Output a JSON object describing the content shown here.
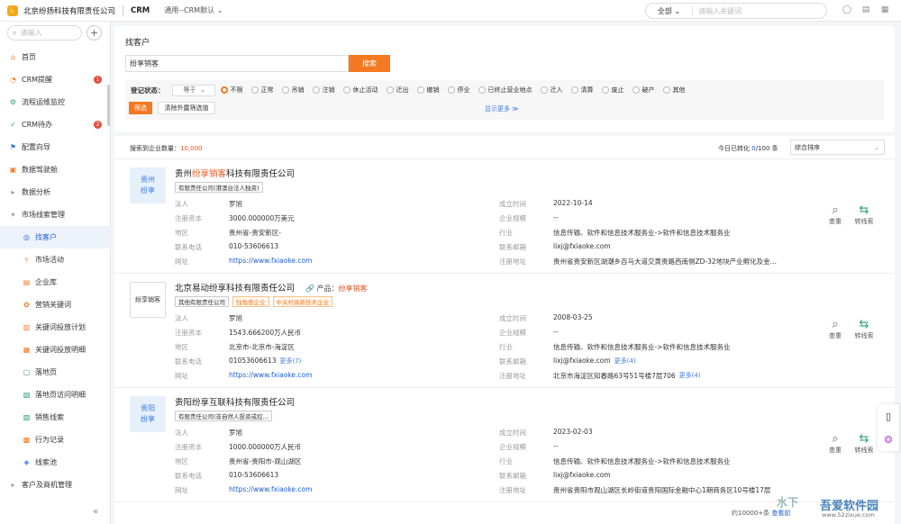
{
  "topbar": {
    "company": "北京纷扬科技有限责任公司",
    "app": "CRM",
    "workspace": "通用--CRM默认",
    "scope": "全部",
    "search_placeholder": "请输入关键词"
  },
  "sidebar": {
    "search_placeholder": "请输入",
    "items": [
      {
        "label": "首页",
        "icon": "home-icon",
        "glyph": "⌂",
        "color": "#f47921"
      },
      {
        "label": "CRM提醒",
        "icon": "bell-icon",
        "glyph": "◔",
        "color": "#f47921",
        "badge": "1"
      },
      {
        "label": "流程运维监控",
        "icon": "flow-icon",
        "glyph": "⚙",
        "color": "#2aa36b"
      },
      {
        "label": "CRM待办",
        "icon": "todo-icon",
        "glyph": "✓",
        "color": "#2aa36b",
        "badge": "2"
      },
      {
        "label": "配置向导",
        "icon": "guide-icon",
        "glyph": "⚑",
        "color": "#3a7be0"
      },
      {
        "label": "数据驾驶舱",
        "icon": "dashboard-icon",
        "glyph": "▣",
        "color": "#f47921"
      },
      {
        "label": "数据分析",
        "icon": "expand-icon",
        "glyph": "▸",
        "color": "#999"
      },
      {
        "label": "市场线索管理",
        "icon": "collapse-icon",
        "glyph": "▾",
        "color": "#999"
      },
      {
        "label": "找客户",
        "icon": "find-customer-icon",
        "glyph": "◎",
        "color": "#1a5ed8",
        "sub": true,
        "active": true
      },
      {
        "label": "市场活动",
        "icon": "activity-icon",
        "glyph": "✧",
        "color": "#f47921",
        "sub": true
      },
      {
        "label": "企业库",
        "icon": "company-icon",
        "glyph": "▤",
        "color": "#f47921",
        "sub": true
      },
      {
        "label": "营销关键词",
        "icon": "keyword-icon",
        "glyph": "✿",
        "color": "#f47921",
        "sub": true
      },
      {
        "label": "关键词投放计划",
        "icon": "plan-icon",
        "glyph": "▥",
        "color": "#f47921",
        "sub": true
      },
      {
        "label": "关键词投放明细",
        "icon": "detail-icon",
        "glyph": "▦",
        "color": "#f47921",
        "sub": true
      },
      {
        "label": "落地页",
        "icon": "landing-icon",
        "glyph": "▢",
        "color": "#2aa36b",
        "sub": true
      },
      {
        "label": "落地页访问明细",
        "icon": "visit-icon",
        "glyph": "▧",
        "color": "#2aa36b",
        "sub": true
      },
      {
        "label": "销售线索",
        "icon": "lead-icon",
        "glyph": "▨",
        "color": "#2aa36b",
        "sub": true
      },
      {
        "label": "行为记录",
        "icon": "record-icon",
        "glyph": "▩",
        "color": "#f47921",
        "sub": true
      },
      {
        "label": "线索池",
        "icon": "pool-icon",
        "glyph": "◈",
        "color": "#3a7be0",
        "sub": true
      },
      {
        "label": "客户及商机管理",
        "icon": "expand-icon",
        "glyph": "▸",
        "color": "#999"
      }
    ]
  },
  "page": {
    "title": "找客户",
    "search_value": "纷享销客",
    "search_btn": "搜索"
  },
  "filter": {
    "label": "登记状态：",
    "op": "等于",
    "options": [
      "不限",
      "正常",
      "吊销",
      "注销",
      "休止活动",
      "迁出",
      "撤销",
      "停业",
      "已终止营业地点",
      "迁入",
      "清算",
      "废止",
      "破产",
      "其他"
    ],
    "selected": "不限",
    "btn_filter": "筛选",
    "btn_clear": "清除外露筛选值",
    "show_more": "显示更多 ≫"
  },
  "results": {
    "count_label": "搜索到企业数量：",
    "count": "10,000",
    "conv_label": "今日已转化",
    "conv": "0",
    "conv_total": "/100 条",
    "sort": "综合排序",
    "field_labels": {
      "legal": "法人",
      "capital": "注册资本",
      "region": "地区",
      "phone": "联系电话",
      "site": "网址",
      "founded": "成立时间",
      "scale": "企业规模",
      "industry": "行业",
      "email": "联系邮箱",
      "address": "注册地址"
    },
    "actions": {
      "view": "查重",
      "convert": "转线索"
    },
    "companies": [
      {
        "logo": "贵州\n纷享",
        "name_pre": "贵州",
        "name_hl": "纷享销客",
        "name_post": "科技有限责任公司",
        "product_label": "",
        "product": "",
        "tags": [
          {
            "t": "有限责任公司(港澳台法人独资)",
            "o": false
          }
        ],
        "legal": "罗旭",
        "capital": "3000.000000万美元",
        "region": "贵州省-贵安新区-",
        "phone": "010-53606613",
        "phone_more": "",
        "site": "https://www.fxiaoke.com",
        "founded": "2022-10-14",
        "scale": "--",
        "industry": "信息传输、软件和信息技术服务业->软件和信息技术服务业",
        "email": "lixj@fxiaoke.com",
        "email_more": "",
        "address": "贵州省贵安新区湖潮乡百马大道交黄贵路西南侧ZD-32地块产业孵化及金…",
        "addr_more": ""
      },
      {
        "logo": "纷享销客",
        "name_pre": "北京易动纷享科技有限责任公司",
        "name_hl": "",
        "name_post": "",
        "product_label": "产品：",
        "product": "纷享销客",
        "tags": [
          {
            "t": "其他有限责任公司",
            "o": false
          },
          {
            "t": "独角兽企业",
            "o": true
          },
          {
            "t": "中关村高新技术企业",
            "o": true
          }
        ],
        "legal": "罗旭",
        "capital": "1543.666200万人民币",
        "region": "北京市-北京市-海淀区",
        "phone": "01053606613",
        "phone_more": "更多(7)",
        "site": "https://www.fxiaoke.com",
        "founded": "2008-03-25",
        "scale": "--",
        "industry": "信息传输、软件和信息技术服务业->软件和信息技术服务业",
        "email": "lixj@fxiaoke.com",
        "email_more": "更多(4)",
        "address": "北京市海淀区知春路63号51号楼7层706",
        "addr_more": "更多(4)"
      },
      {
        "logo": "贵阳\n纷享",
        "name_pre": "贵阳纷享互联科技有限责任公司",
        "name_hl": "",
        "name_post": "",
        "product_label": "",
        "product": "",
        "tags": [
          {
            "t": "有限责任公司(非自然人投资或控…",
            "o": false
          }
        ],
        "legal": "罗旭",
        "capital": "1000.000000万人民币",
        "region": "贵州省-贵阳市-观山湖区",
        "phone": "010-53606613",
        "phone_more": "",
        "site": "https://www.fxiaoke.com",
        "founded": "2023-02-03",
        "scale": "--",
        "industry": "信息传输、软件和信息技术服务业->软件和信息技术服务业",
        "email": "lixj@fxiaoke.com",
        "email_more": "",
        "address": "贵州省贵阳市观山湖区长岭街道贵阳国际金融中心1期商务区10号楼17层",
        "addr_more": ""
      }
    ],
    "footer_total": "约10000+条",
    "footer_link": "查看前"
  },
  "watermark": {
    "text": "吾爱软件园",
    "url": "www.52zixue.com"
  }
}
